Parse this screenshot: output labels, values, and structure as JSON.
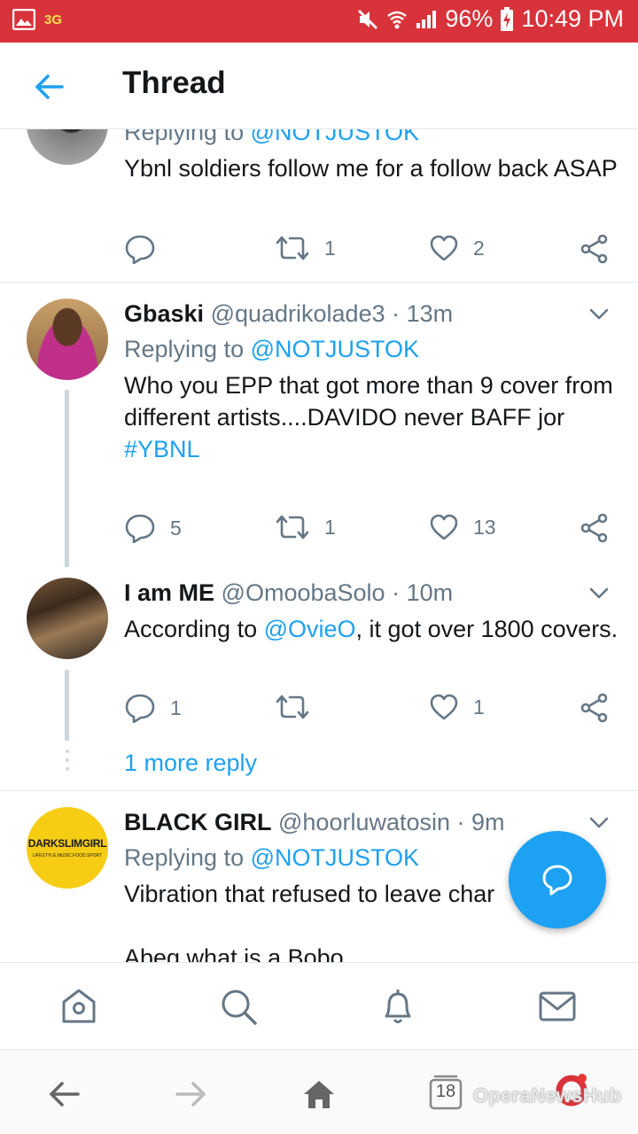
{
  "status_bar": {
    "network": "3G",
    "battery": "96%",
    "time": "10:49 PM"
  },
  "header": {
    "title": "Thread"
  },
  "tweets": [
    {
      "reply_prefix": "Replying to ",
      "reply_to": "@NOTJUSTOK",
      "text": "Ybnl soldiers follow me for a follow back ASAP",
      "replies": "",
      "retweets": "1",
      "likes": "2"
    },
    {
      "name": "Gbaski",
      "handle": "@quadrikolade3",
      "dot": " · ",
      "time": "13m",
      "reply_prefix": "Replying to ",
      "reply_to": "@NOTJUSTOK",
      "text": "Who you EPP that got more than 9 cover from different artists....DAVIDO never BAFF jor",
      "hashtag": "#YBNL",
      "replies": "5",
      "retweets": "1",
      "likes": "13"
    },
    {
      "name": "I am ME",
      "handle": "@OmoobaSolo",
      "dot": " · ",
      "time": "10m",
      "text_before": "According to ",
      "mention": "@OvieO",
      "text_after": ", it got over 1800 covers.",
      "replies": "1",
      "retweets": "",
      "likes": "1"
    },
    {
      "name": "BLACK GIRL",
      "handle": "@hoorluwatosin",
      "dot": " · ",
      "time": "9m",
      "reply_prefix": "Replying to ",
      "reply_to": "@NOTJUSTOK",
      "text": "Vibration that refused to leave char",
      "text2": "Abeg what is a Bobo",
      "avatar_text": "DARKSLIMGIRL",
      "avatar_subtext": "LIFESTYLE.MUSIC.FOOD.SPORT"
    }
  ],
  "more_replies": "1 more reply",
  "browser": {
    "tab_count": "18",
    "watermark": "OperaNewsHub"
  },
  "colors": {
    "status_bar": "#d8333b",
    "accent": "#1da1f2",
    "muted": "#657786"
  }
}
